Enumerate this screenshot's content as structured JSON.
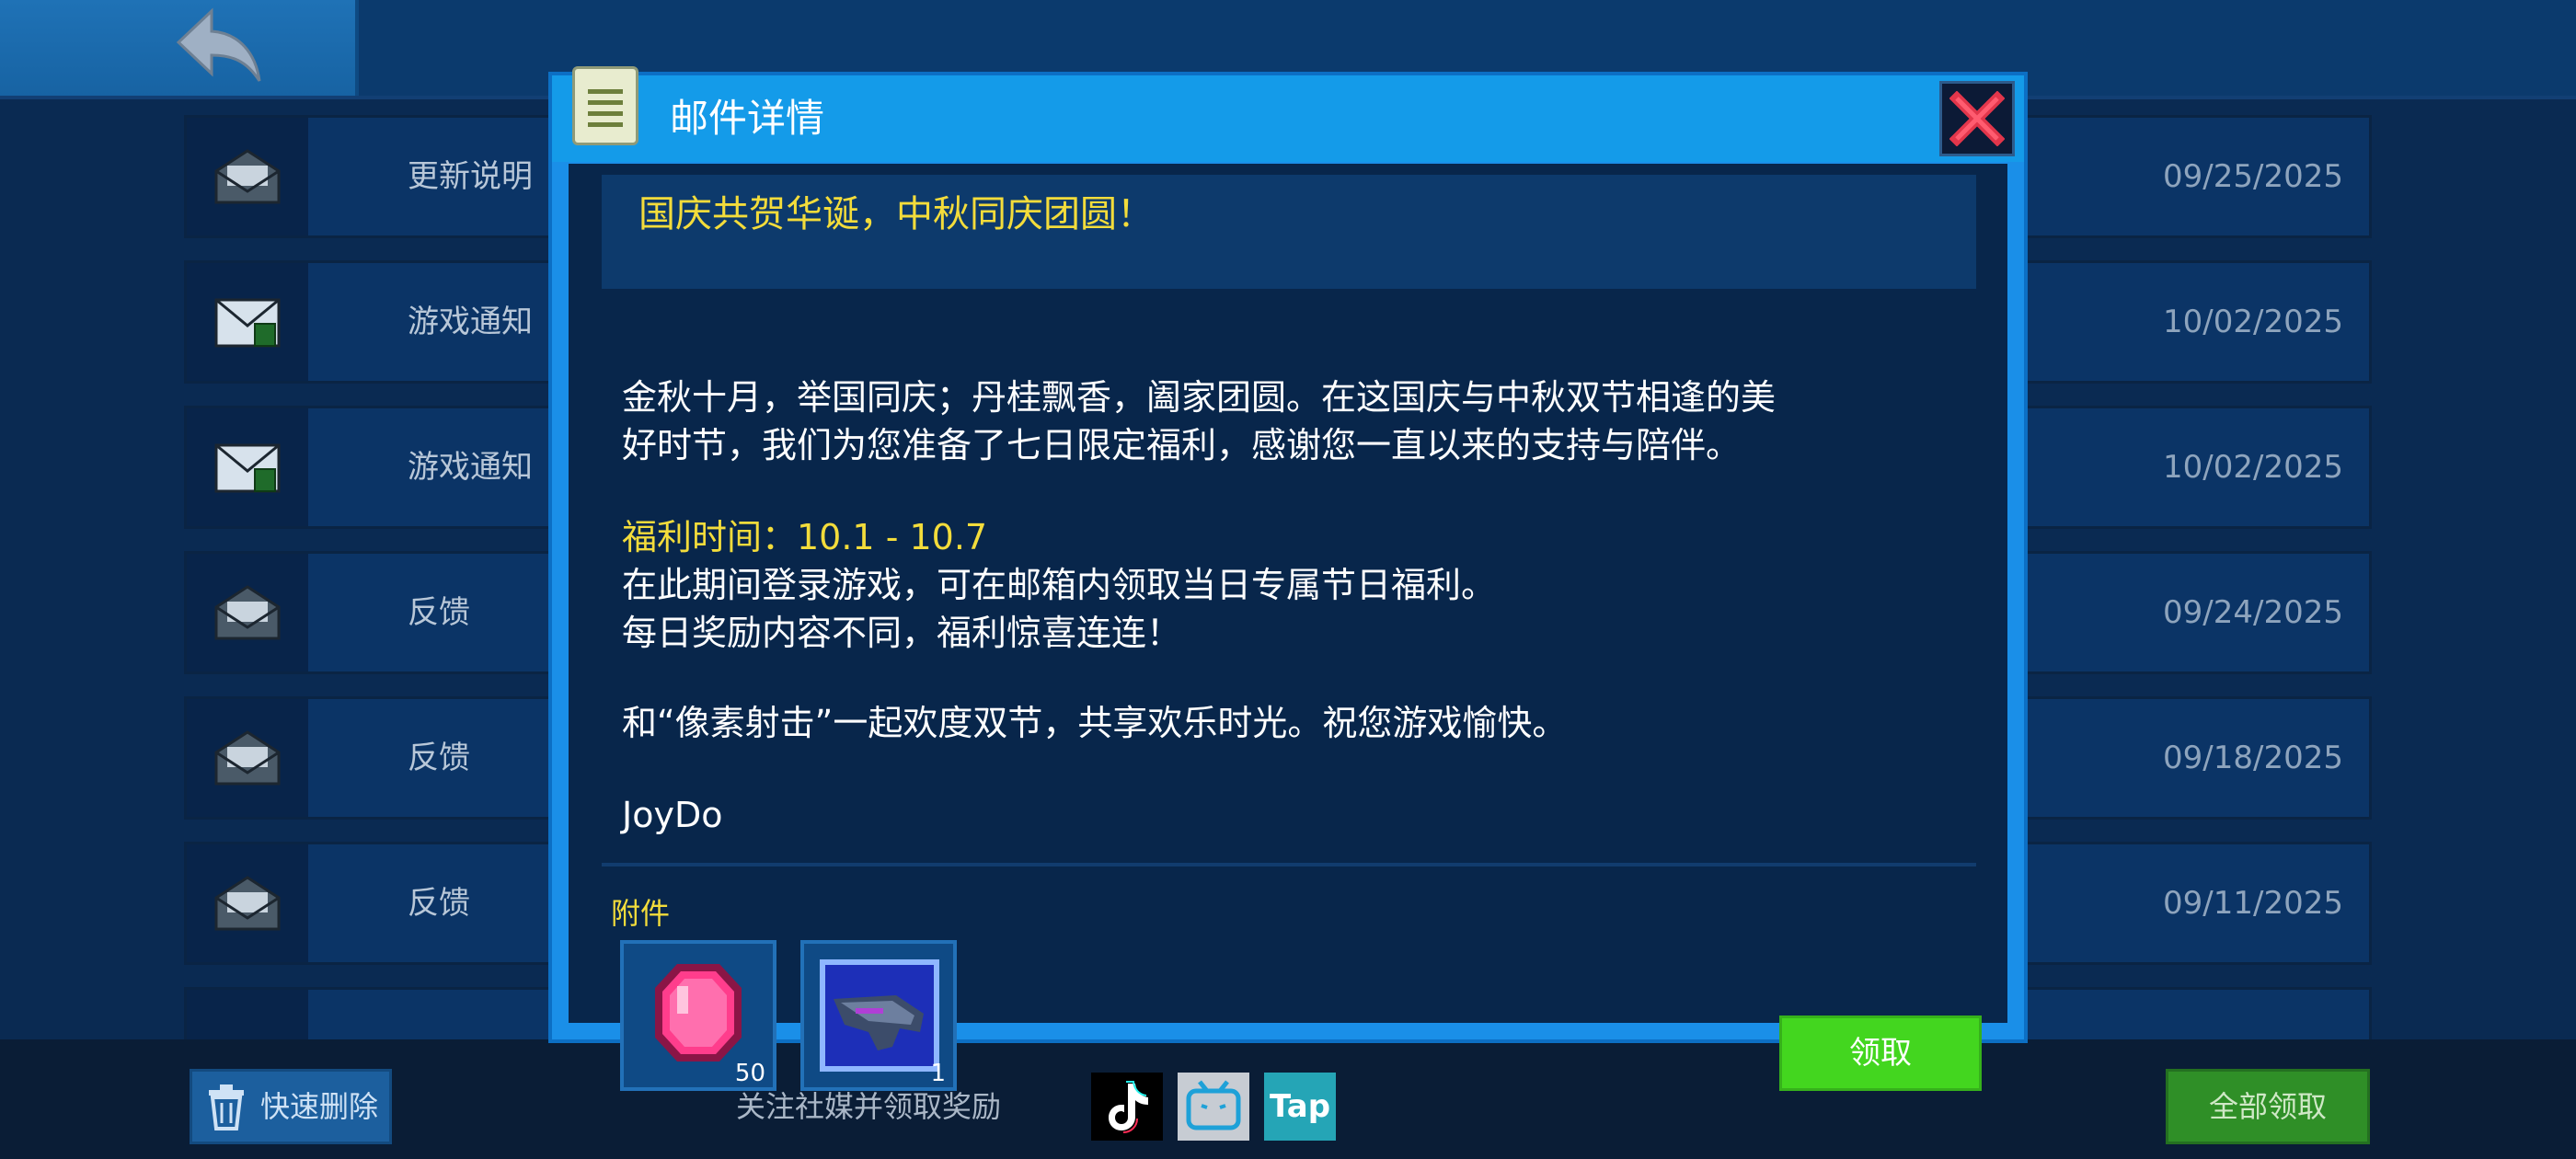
{
  "mail_detail": {
    "title": "邮件详情",
    "subject": "国庆共贺华诞，中秋同庆团圆！",
    "body": {
      "intro_line1": "金秋十月，举国同庆；丹桂飘香，阖家团圆。在这国庆与中秋双节相逢的美",
      "intro_line2": "好时节，我们为您准备了七日限定福利，感谢您一直以来的支持与陪伴。",
      "benefit_time": "福利时间：10.1 - 10.7",
      "line_login": "在此期间登录游戏，可在邮箱内领取当日专属节日福利。",
      "line_daily": "每日奖励内容不同，福利惊喜连连！",
      "line_wish": "和“像素射击”一起欢度双节，共享欢乐时光。祝您游戏愉快。",
      "signature": "JoyDo"
    },
    "attachments_label": "附件",
    "attachments": [
      {
        "icon": "pink-gem-icon",
        "quantity": "50"
      },
      {
        "icon": "gun-icon",
        "quantity": "1"
      }
    ],
    "claim_label": "领取"
  },
  "mail_list": [
    {
      "title": "更新说明",
      "date": "09/25/2025",
      "icon": "opened-envelope-icon"
    },
    {
      "title": "游戏通知",
      "date": "10/02/2025",
      "icon": "closed-envelope-with-attachment-icon"
    },
    {
      "title": "游戏通知",
      "date": "10/02/2025",
      "icon": "closed-envelope-with-attachment-icon"
    },
    {
      "title": "反馈",
      "date": "09/24/2025",
      "icon": "opened-envelope-icon"
    },
    {
      "title": "反馈",
      "date": "09/18/2025",
      "icon": "opened-envelope-icon"
    },
    {
      "title": "反馈",
      "date": "09/11/2025",
      "icon": "opened-envelope-icon"
    }
  ],
  "bottom_bar": {
    "quick_delete": "快速删除",
    "follow_text": "关注社媒并领取奖励",
    "tap_label": "Tap",
    "claim_all": "全部领取"
  },
  "colors": {
    "accent_blue": "#1a8fe8",
    "title_yellow": "#f3dc3b",
    "claim_green": "#43d61f"
  }
}
